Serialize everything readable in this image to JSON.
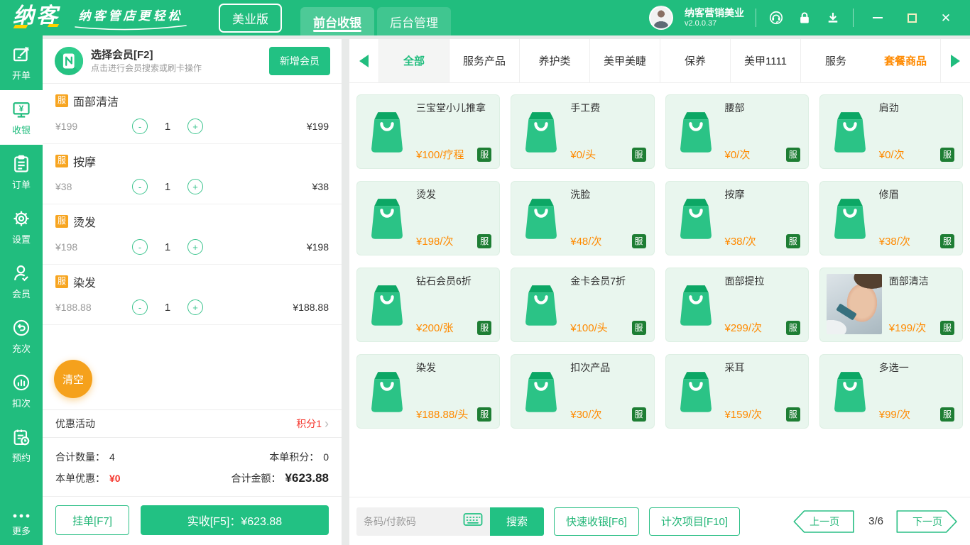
{
  "colors": {
    "primary_green": "#21bd7e",
    "button_green": "#22c183",
    "badge_dark_green": "#1e7e34",
    "badge_orange": "#f7a521",
    "price_orange": "#ff8a00",
    "alert_red": "#f5352c",
    "card_bg": "#e9f6ee"
  },
  "topbar": {
    "logo": "纳客",
    "slogan": "纳客管店更轻松",
    "edition": "美业版",
    "tabs": [
      {
        "label": "前台收银"
      },
      {
        "label": "后台管理"
      }
    ],
    "account": {
      "name": "纳客营销美业",
      "version": "v2.0.0.37"
    }
  },
  "sidebar": {
    "items": [
      {
        "label": "开单"
      },
      {
        "label": "收银"
      },
      {
        "label": "订单"
      },
      {
        "label": "设置"
      },
      {
        "label": "会员"
      },
      {
        "label": "充次"
      },
      {
        "label": "扣次"
      },
      {
        "label": "预约"
      },
      {
        "label": "更多"
      }
    ]
  },
  "member": {
    "title": "选择会员[F2]",
    "subtitle": "点击进行会员搜索或刷卡操作",
    "add_button": "新增会员"
  },
  "cart": {
    "stepper": {
      "minus": "-",
      "plus": "+"
    },
    "items": [
      {
        "badge": "服",
        "name": "面部清洁",
        "price": "¥199",
        "qty": "1",
        "total": "¥199"
      },
      {
        "badge": "服",
        "name": "按摩",
        "price": "¥38",
        "qty": "1",
        "total": "¥38"
      },
      {
        "badge": "服",
        "name": "烫发",
        "price": "¥198",
        "qty": "1",
        "total": "¥198"
      },
      {
        "badge": "服",
        "name": "染发",
        "price": "¥188.88",
        "qty": "1",
        "total": "¥188.88"
      }
    ],
    "clear_button": "清空",
    "promo": {
      "label": "优惠活动",
      "value": "积分1",
      "arrow": "›"
    },
    "summary": {
      "qty_label": "合计数量：",
      "qty": "4",
      "points_label": "本单积分：",
      "points": "0",
      "discount_label": "本单优惠：",
      "discount": "¥0",
      "total_label": "合计金额：",
      "total": "¥623.88"
    },
    "hold_button": "挂单[F7]",
    "pay_button": "实收[F5]：¥623.88"
  },
  "categories": [
    {
      "label": "全部"
    },
    {
      "label": "服务产品"
    },
    {
      "label": "养护类"
    },
    {
      "label": "美甲美睫"
    },
    {
      "label": "保养"
    },
    {
      "label": "美甲1111"
    },
    {
      "label": "服务"
    },
    {
      "label": "套餐商品"
    }
  ],
  "products": [
    {
      "name": "三宝堂小儿推拿",
      "price": "¥100/疗程",
      "badge": "服"
    },
    {
      "name": "手工费",
      "price": "¥0/头",
      "badge": "服"
    },
    {
      "name": "腰部",
      "price": "¥0/次",
      "badge": "服"
    },
    {
      "name": "肩劲",
      "price": "¥0/次",
      "badge": "服"
    },
    {
      "name": "烫发",
      "price": "¥198/次",
      "badge": "服"
    },
    {
      "name": "洗脸",
      "price": "¥48/次",
      "badge": "服"
    },
    {
      "name": "按摩",
      "price": "¥38/次",
      "badge": "服"
    },
    {
      "name": "修眉",
      "price": "¥38/次",
      "badge": "服"
    },
    {
      "name": "钻石会员6折",
      "price": "¥200/张",
      "badge": "服"
    },
    {
      "name": "金卡会员7折",
      "price": "¥100/头",
      "badge": "服"
    },
    {
      "name": "面部提拉",
      "price": "¥299/次",
      "badge": "服"
    },
    {
      "name": "面部清洁",
      "price": "¥199/次",
      "badge": "服"
    },
    {
      "name": "染发",
      "price": "¥188.88/头",
      "badge": "服"
    },
    {
      "name": "扣次产品",
      "price": "¥30/次",
      "badge": "服"
    },
    {
      "name": "采耳",
      "price": "¥159/次",
      "badge": "服"
    },
    {
      "name": "多选一",
      "price": "¥99/次",
      "badge": "服"
    }
  ],
  "bottombar": {
    "search_placeholder": "条码/付款码",
    "search_button": "搜索",
    "quick_button": "快速收银[F6]",
    "count_button": "计次项目[F10]",
    "pagination": {
      "prev": "上一页",
      "current": "3/6",
      "next": "下一页"
    }
  }
}
